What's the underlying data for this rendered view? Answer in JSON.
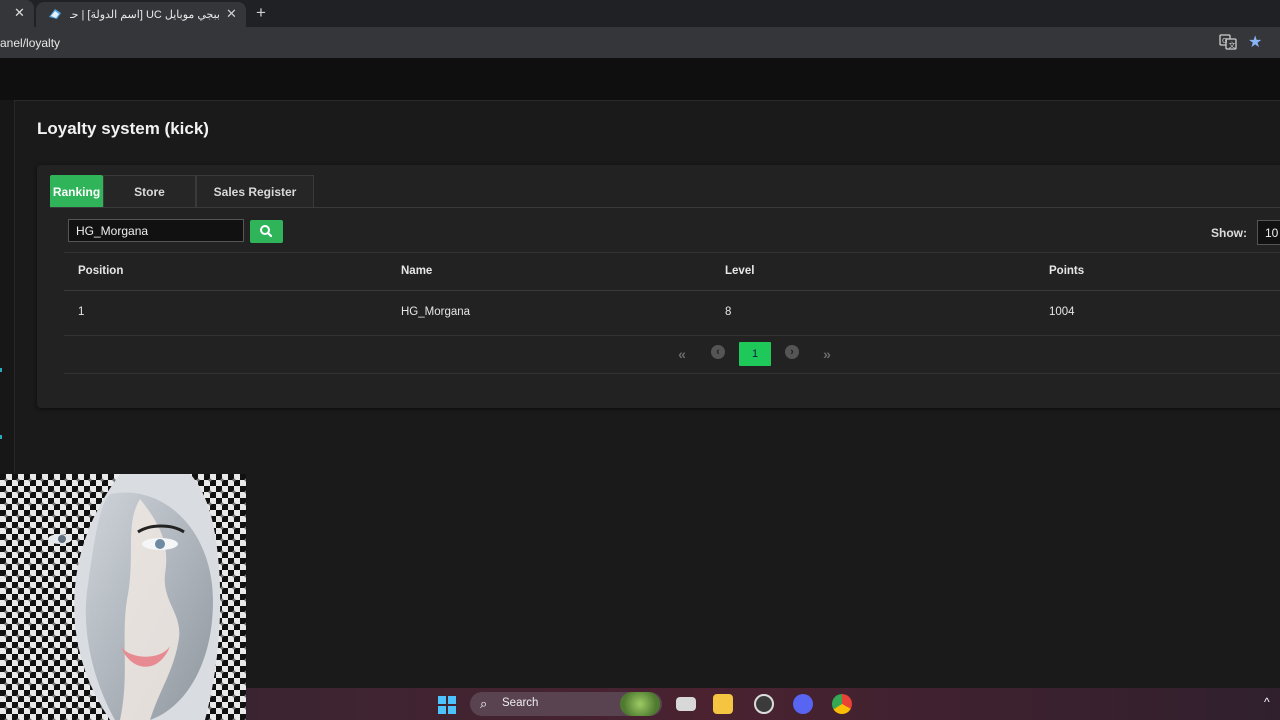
{
  "browser": {
    "prev_tab_close": "✕",
    "active_tab_title": "ببجي موبايل UC [اسم الدولة] | حـ",
    "active_tab_close": "✕",
    "new_tab": "+",
    "url": "anel/loyalty"
  },
  "page": {
    "title": "Loyalty system (kick)"
  },
  "tabs": [
    {
      "label": "Ranking",
      "active": true
    },
    {
      "label": "Store",
      "active": false
    },
    {
      "label": "Sales Register",
      "active": false
    }
  ],
  "search": {
    "value": "HG_Morgana"
  },
  "show": {
    "label": "Show:",
    "value": "10"
  },
  "table": {
    "headers": [
      "Position",
      "Name",
      "Level",
      "Points"
    ],
    "rows": [
      [
        "1",
        "HG_Morgana",
        "8",
        "1004"
      ]
    ]
  },
  "pagination": {
    "first": "«",
    "last": "»",
    "current": "1"
  },
  "taskbar": {
    "search_label": "Search"
  },
  "colors": {
    "accent": "#2fb45a",
    "pager_active": "#1ec95a"
  }
}
